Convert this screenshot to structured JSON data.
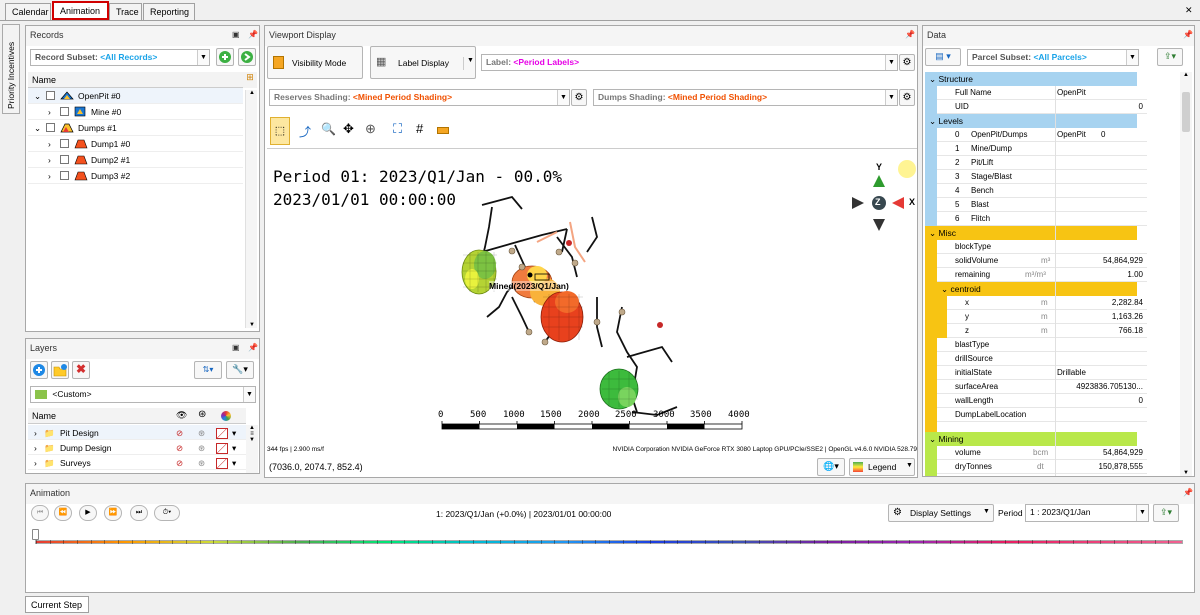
{
  "tabs": [
    "Calendar",
    "Animation",
    "Trace",
    "Reporting"
  ],
  "side_tab": "Priority Incentives",
  "records": {
    "title": "Records",
    "subset_label": "Record Subset:",
    "subset_value": "<All Records>",
    "col_name": "Name",
    "items": [
      "OpenPit #0",
      "Mine #0",
      "Dumps #1",
      "Dump1 #0",
      "Dump2 #1",
      "Dump3 #2"
    ]
  },
  "layers": {
    "title": "Layers",
    "custom": "<Custom>",
    "col_name": "Name",
    "items": [
      "Pit Design",
      "Dump Design",
      "Surveys"
    ]
  },
  "viewport": {
    "title": "Viewport Display",
    "visibility_mode": "Visibility Mode",
    "label_display": "Label Display",
    "label_prefix": "Label:",
    "label_value": "<Period Labels>",
    "reserves_prefix": "Reserves Shading:",
    "reserves_value": "<Mined Period Shading>",
    "dumps_prefix": "Dumps Shading:",
    "dumps_value": "<Mined Period Shading>",
    "period_line1": "Period 01: 2023/Q1/Jan - 00.0%",
    "period_line2": "2023/01/01 00:00:00",
    "mined_label": "Mined(2023/Q1/Jan)",
    "scale_labels": [
      "0",
      "500",
      "1000",
      "1500",
      "2000",
      "2500",
      "3000",
      "3500",
      "4000"
    ],
    "axis_y": "Y",
    "axis_x": "X",
    "axis_z": "Z",
    "fps": "344 fps | 2.900 ms/f",
    "gpu": "NVIDIA Corporation NVIDIA GeForce RTX 3080 Laptop GPU/PCIe/SSE2 | OpenGL v4.6.0 NVIDIA 528.79",
    "coords": "(7036.0, 2074.7, 852.4)",
    "legend": "Legend"
  },
  "data": {
    "title": "Data",
    "subset_label": "Parcel Subset:",
    "subset_value": "<All Parcels>",
    "structure": {
      "title": "Structure",
      "rows": [
        [
          "Full Name",
          "",
          "OpenPit"
        ],
        [
          "UID",
          "",
          "0"
        ]
      ]
    },
    "levels": {
      "title": "Levels",
      "rows": [
        [
          "0",
          "OpenPit/Dumps",
          "OpenPit",
          "0"
        ],
        [
          "1",
          "Mine/Dump",
          "",
          ""
        ],
        [
          "2",
          "Pit/Lift",
          "",
          ""
        ],
        [
          "3",
          "Stage/Blast",
          "",
          ""
        ],
        [
          "4",
          "Bench",
          "",
          ""
        ],
        [
          "5",
          "Blast",
          "",
          ""
        ],
        [
          "6",
          "Flitch",
          "",
          ""
        ]
      ]
    },
    "misc": {
      "title": "Misc",
      "rows": [
        [
          "blockType",
          "",
          ""
        ],
        [
          "solidVolume",
          "m³",
          "54,864,929"
        ],
        [
          "remaining",
          "m³/m³",
          "1.00"
        ]
      ]
    },
    "centroid": {
      "title": "centroid",
      "rows": [
        [
          "x",
          "m",
          "2,282.84"
        ],
        [
          "y",
          "m",
          "1,163.26"
        ],
        [
          "z",
          "m",
          "766.18"
        ]
      ]
    },
    "misc2": {
      "rows": [
        [
          "blastType",
          "",
          ""
        ],
        [
          "drillSource",
          "",
          ""
        ],
        [
          "initialState",
          "",
          "Drillable"
        ],
        [
          "surfaceArea",
          "",
          "4923836.705130..."
        ],
        [
          "wallLength",
          "",
          "0"
        ],
        [
          "DumpLabelLocation",
          "",
          ""
        ]
      ]
    },
    "mining": {
      "title": "Mining",
      "rows": [
        [
          "volume",
          "bcm",
          "54,864,929"
        ],
        [
          "dryTonnes",
          "dt",
          "150,878,555"
        ]
      ]
    }
  },
  "animation": {
    "title": "Animation",
    "status": "1: 2023/Q1/Jan (+0.0%) | 2023/01/01 00:00:00",
    "display_settings": "Display Settings",
    "period_label": "Period",
    "period_value": "1 : 2023/Q1/Jan",
    "current_step": "Current Step"
  },
  "timeline_colors": [
    "#e53935",
    "#ff9800",
    "#cddc39",
    "#4caf50",
    "#00e676",
    "#00bcd4",
    "#2196f3",
    "#1e3fe0",
    "#3f51b5",
    "#7b1fa2",
    "#9c27b0",
    "#e91e63",
    "#ec407a",
    "#f06292"
  ]
}
